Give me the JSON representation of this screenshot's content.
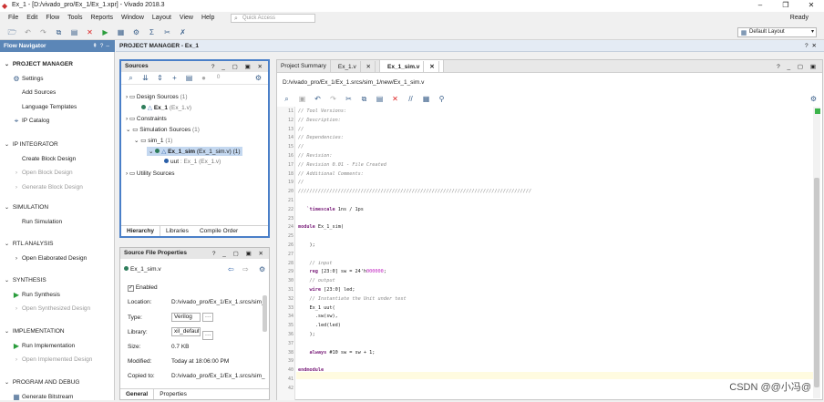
{
  "window": {
    "title": "Ex_1 - [D:/vivado_pro/Ex_1/Ex_1.xpr] - Vivado 2018.3",
    "status": "Ready"
  },
  "menu": [
    "File",
    "Edit",
    "Flow",
    "Tools",
    "Reports",
    "Window",
    "Layout",
    "View",
    "Help"
  ],
  "quick_access": "Quick Access",
  "layout_select": "Default Layout",
  "flow_nav": {
    "title": "Flow Navigator",
    "sections": [
      {
        "label": "PROJECT MANAGER",
        "items": [
          "Settings",
          "Add Sources",
          "Language Templates",
          "IP Catalog"
        ]
      },
      {
        "label": "IP INTEGRATOR",
        "items": [
          "Create Block Design",
          "Open Block Design",
          "Generate Block Design"
        ]
      },
      {
        "label": "SIMULATION",
        "items": [
          "Run Simulation"
        ]
      },
      {
        "label": "RTL ANALYSIS",
        "items": [
          "Open Elaborated Design"
        ]
      },
      {
        "label": "SYNTHESIS",
        "items": [
          "Run Synthesis",
          "Open Synthesized Design"
        ]
      },
      {
        "label": "IMPLEMENTATION",
        "items": [
          "Run Implementation",
          "Open Implemented Design"
        ]
      },
      {
        "label": "PROGRAM AND DEBUG",
        "items": [
          "Generate Bitstream"
        ]
      }
    ]
  },
  "pm_header": "PROJECT MANAGER - Ex_1",
  "sources": {
    "title": "Sources",
    "badge": "0",
    "design_sources": "Design Sources",
    "design_count": "(1)",
    "ex1": "Ex_1",
    "ex1_file": "(Ex_1.v)",
    "constraints": "Constraints",
    "sim_sources": "Simulation Sources",
    "sim_count": "(1)",
    "sim_1": "sim_1",
    "sim_1_count": "(1)",
    "ex1_sim": "Ex_1_sim",
    "ex1_sim_file": "(Ex_1_sim.v) (1)",
    "uut": "uut",
    "uut_file": ": Ex_1 (Ex_1.v)",
    "utility": "Utility Sources",
    "tabs": [
      "Hierarchy",
      "Libraries",
      "Compile Order"
    ]
  },
  "sfp": {
    "title": "Source File Properties",
    "file": "Ex_1_sim.v",
    "enabled": "Enabled",
    "location_label": "Location:",
    "location_value": "D:/vivado_pro/Ex_1/Ex_1.srcs/sim_",
    "type_label": "Type:",
    "type_value": "Verilog",
    "library_label": "Library:",
    "library_value": "xil_defaultlib",
    "size_label": "Size:",
    "size_value": "0.7 KB",
    "modified_label": "Modified:",
    "modified_value": "Today at 18:06:00 PM",
    "copied_label": "Copied to:",
    "copied_value": "D:/vivado_pro/Ex_1/Ex_1.srcs/sim_",
    "tabs": [
      "General",
      "Properties"
    ]
  },
  "editor": {
    "tabs": [
      "Project Summary",
      "Ex_1.v",
      "Ex_1_sim.v"
    ],
    "path": "D:/vivado_pro/Ex_1/Ex_1.srcs/sim_1/new/Ex_1_sim.v",
    "lines": [
      {
        "n": "11",
        "t": "// Tool Versions:",
        "c": "cm"
      },
      {
        "n": "12",
        "t": "// Description:",
        "c": "cm"
      },
      {
        "n": "13",
        "t": "//",
        "c": "cm"
      },
      {
        "n": "14",
        "t": "// Dependencies:",
        "c": "cm"
      },
      {
        "n": "15",
        "t": "//",
        "c": "cm"
      },
      {
        "n": "16",
        "t": "// Revision:",
        "c": "cm"
      },
      {
        "n": "17",
        "t": "// Revision 0.01 - File Created",
        "c": "cm"
      },
      {
        "n": "18",
        "t": "// Additional Comments:",
        "c": "cm"
      },
      {
        "n": "19",
        "t": "//",
        "c": "cm"
      },
      {
        "n": "20",
        "t": "//////////////////////////////////////////////////////////////////////////////////",
        "c": "cm"
      },
      {
        "n": "21",
        "t": "",
        "c": ""
      },
      {
        "n": "22",
        "t": "   `timescale 1ns / 1ps",
        "c": "ts"
      },
      {
        "n": "23",
        "t": "",
        "c": ""
      },
      {
        "n": "24",
        "t": "module Ex_1_sim(",
        "c": "mod"
      },
      {
        "n": "25",
        "t": "",
        "c": ""
      },
      {
        "n": "26",
        "t": "    );",
        "c": ""
      },
      {
        "n": "27",
        "t": "",
        "c": ""
      },
      {
        "n": "28",
        "t": "    // input",
        "c": "cm"
      },
      {
        "n": "29",
        "t": "    reg [23:0] sw = 24'h000000;",
        "c": "reg"
      },
      {
        "n": "30",
        "t": "    // output",
        "c": "cm"
      },
      {
        "n": "31",
        "t": "    wire [23:0] led;",
        "c": "wire"
      },
      {
        "n": "32",
        "t": "    // Instantiate the Unit under test",
        "c": "cm"
      },
      {
        "n": "33",
        "t": "    Ex_1 uut(",
        "c": ""
      },
      {
        "n": "34",
        "t": "      .sw(sw),",
        "c": ""
      },
      {
        "n": "35",
        "t": "      .led(led)",
        "c": ""
      },
      {
        "n": "36",
        "t": "    );",
        "c": ""
      },
      {
        "n": "37",
        "t": "",
        "c": ""
      },
      {
        "n": "38",
        "t": "    always #10 sw = sw + 1;",
        "c": "alw"
      },
      {
        "n": "39",
        "t": "",
        "c": ""
      },
      {
        "n": "40",
        "t": "endmodule",
        "c": "kw"
      },
      {
        "n": "41",
        "t": "",
        "c": ""
      },
      {
        "n": "42",
        "t": "",
        "c": ""
      }
    ]
  },
  "watermark": "CSDN @@小冯@"
}
